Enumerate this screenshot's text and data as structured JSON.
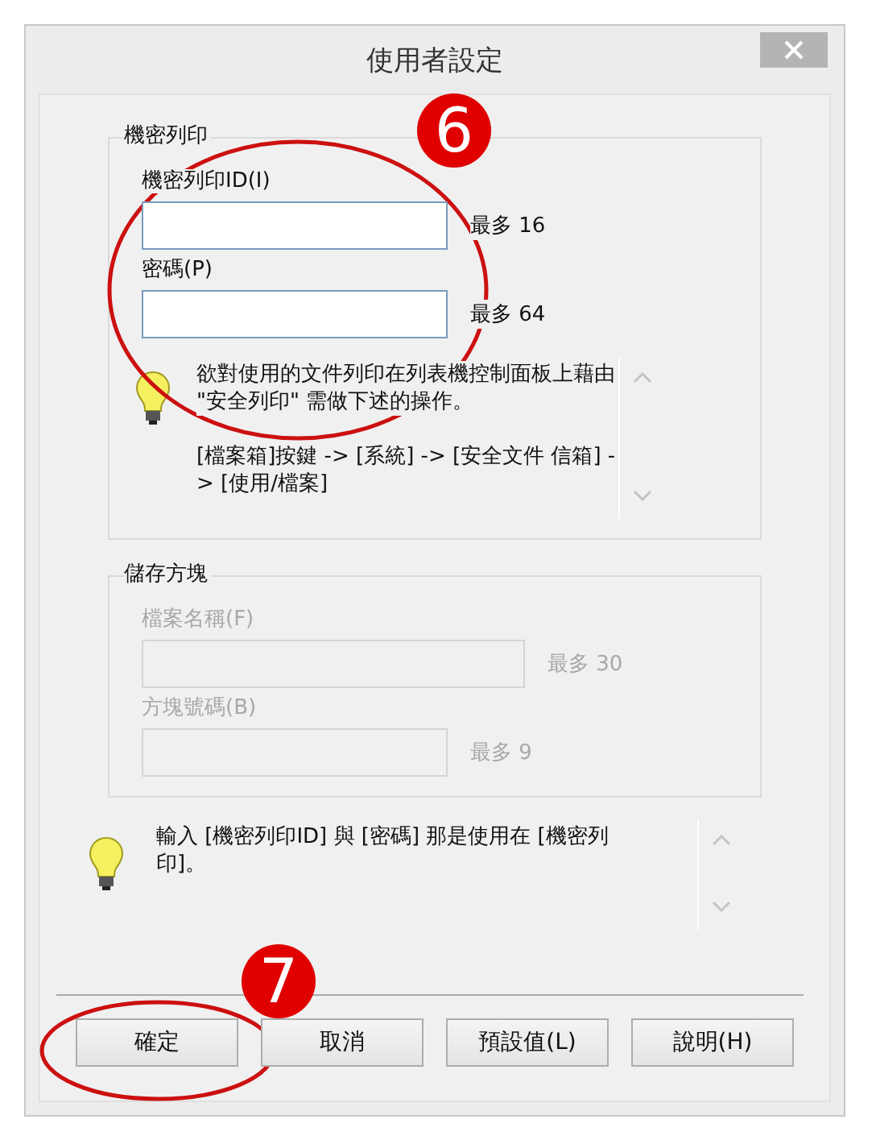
{
  "window": {
    "title": "使用者設定"
  },
  "groups": [
    {
      "title": "機密列印",
      "disabled": false,
      "fields": [
        {
          "label": "機密列印ID(I)",
          "limit": "最多 16",
          "kind": "short"
        },
        {
          "label": "密碼(P)",
          "limit": "最多 64",
          "kind": "short"
        }
      ],
      "info": [
        "欲對使用的文件列印在列表機控制面板上藉由 \"安全列印\" 需做下述的操作。",
        "[檔案箱]按鍵 -> [系統] -> [安全文件 信箱] -> [使用/檔案]"
      ]
    },
    {
      "title": "儲存方塊",
      "disabled": true,
      "fields": [
        {
          "label": "檔案名稱(F)",
          "limit": "最多 30",
          "kind": "long"
        },
        {
          "label": "方塊號碼(B)",
          "limit": "最多 9",
          "kind": "short"
        }
      ]
    }
  ],
  "hint": "輸入 [機密列印ID] 與 [密碼] 那是使用在 [機密列印]。",
  "buttons": [
    "確定",
    "取消",
    "預設值(L)",
    "說明(H)"
  ],
  "annotations": [
    {
      "label": "6"
    },
    {
      "label": "7"
    }
  ]
}
